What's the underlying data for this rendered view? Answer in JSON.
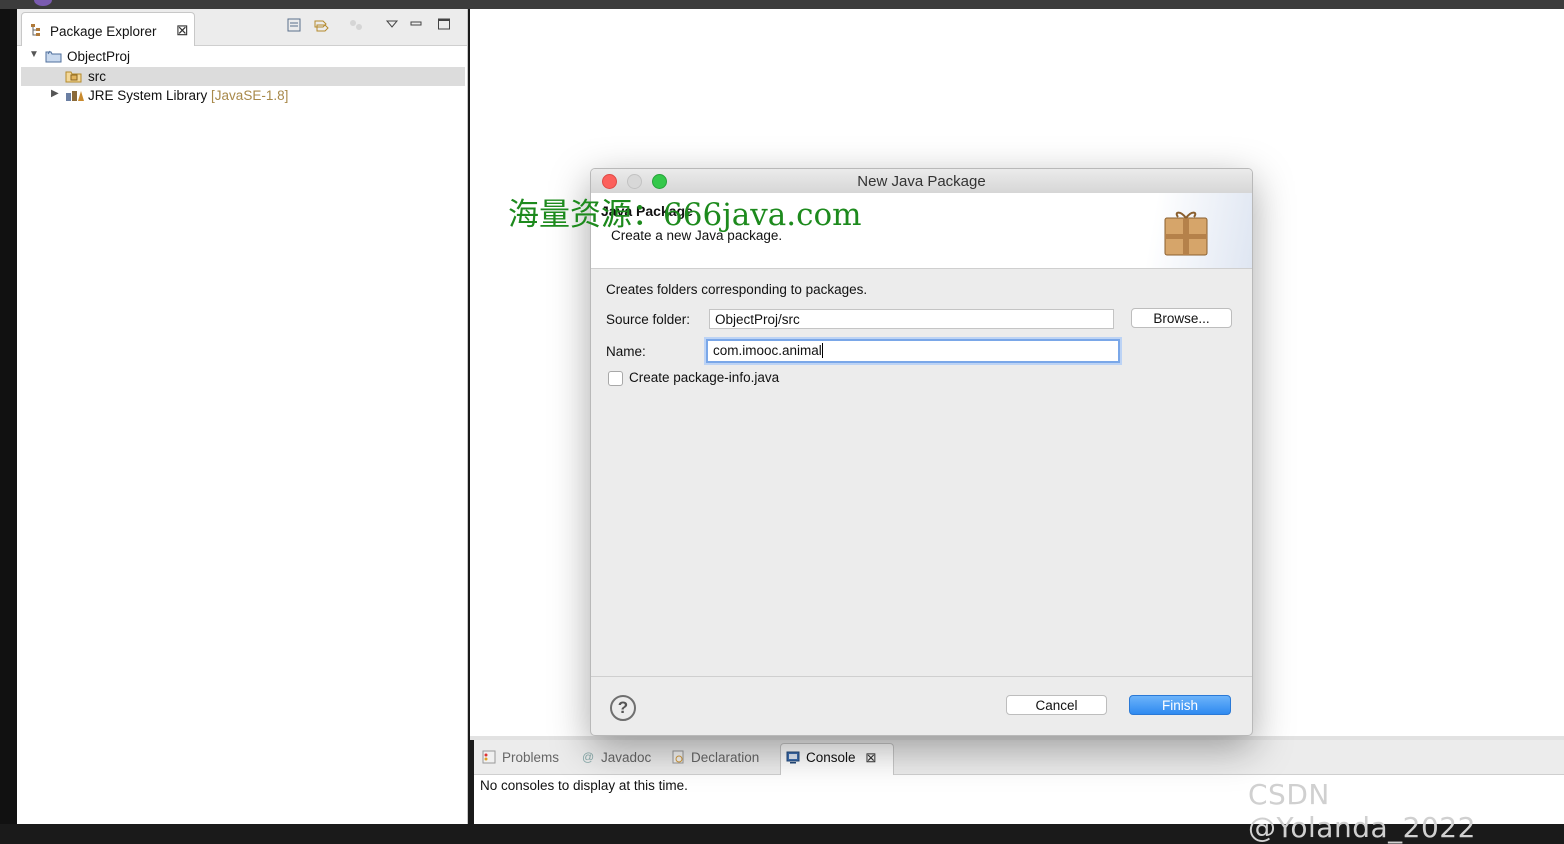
{
  "explorer": {
    "tab_label": "Package Explorer",
    "close_glyph": "⊠",
    "tree": [
      {
        "label": "ObjectProj",
        "decoration": "",
        "expanded": true
      },
      {
        "label": "src",
        "decoration": ""
      },
      {
        "label": "JRE System Library",
        "decoration": "[JavaSE-1.8]"
      }
    ]
  },
  "watermark": "海量资源：666java.com",
  "dialog": {
    "title": "New Java Package",
    "header_title": "Java Package",
    "header_subtitle": "Create a new Java package.",
    "description": "Creates folders corresponding to packages.",
    "source_folder_label": "Source folder:",
    "source_folder_value": "ObjectProj/src",
    "browse_label": "Browse...",
    "name_label": "Name:",
    "name_value": "com.imooc.animal",
    "checkbox_label": "Create package-info.java",
    "checkbox_checked": false,
    "help_glyph": "?",
    "cancel_label": "Cancel",
    "finish_label": "Finish"
  },
  "bottom_panel": {
    "tabs": [
      {
        "label": "Problems",
        "icon": "problems-icon"
      },
      {
        "label": "Javadoc",
        "icon": "javadoc-icon"
      },
      {
        "label": "Declaration",
        "icon": "declaration-icon"
      },
      {
        "label": "Console",
        "icon": "console-icon",
        "active": true
      }
    ],
    "console_message": "No consoles to display at this time."
  },
  "csdn_watermark": "CSDN @Yolanda_2022",
  "colors": {
    "finish_button": "#2f8af0",
    "focus_ring": "#7aa7e8",
    "watermark_green": "#1d8a1d",
    "close_red": "#fc605c",
    "zoom_green": "#34c84a"
  }
}
